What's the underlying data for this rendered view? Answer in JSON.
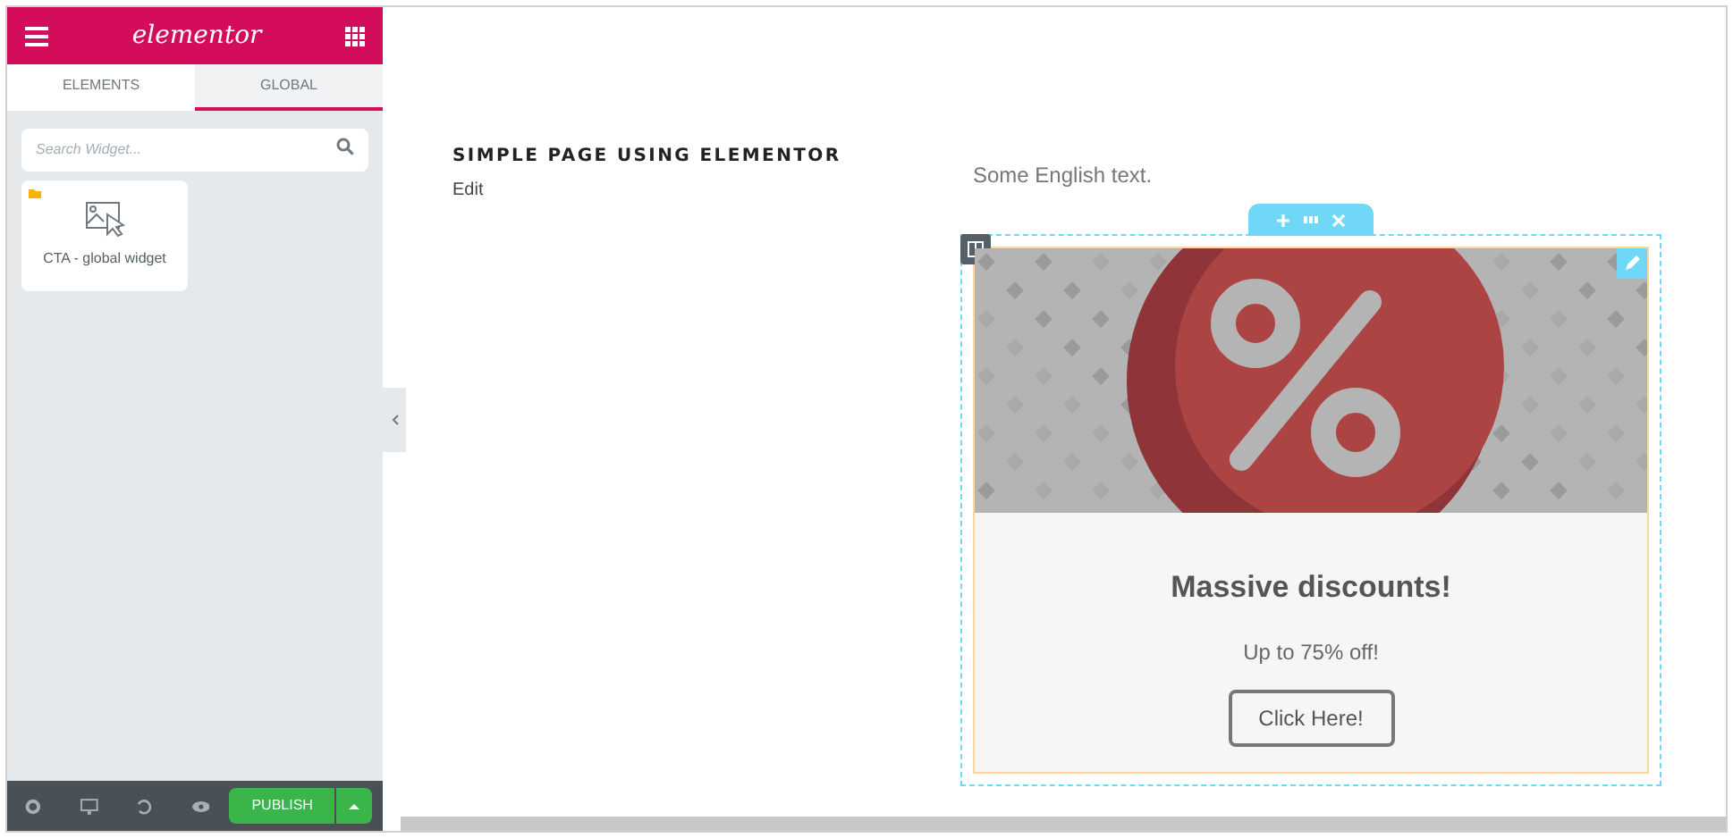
{
  "sidebar": {
    "logo": "elementor",
    "tabs": [
      {
        "label": "ELEMENTS",
        "selected": false
      },
      {
        "label": "GLOBAL",
        "selected": true
      }
    ],
    "search": {
      "placeholder": "Search Widget..."
    },
    "widgets": [
      {
        "label": "CTA - global widget"
      }
    ],
    "publish": "PUBLISH"
  },
  "page": {
    "title": "SIMPLE PAGE USING ELEMENTOR",
    "edit_link": "Edit",
    "text": "Some English text.",
    "cta": {
      "heading": "Massive discounts!",
      "subheading": "Up to 75% off!",
      "button": "Click Here!"
    }
  }
}
